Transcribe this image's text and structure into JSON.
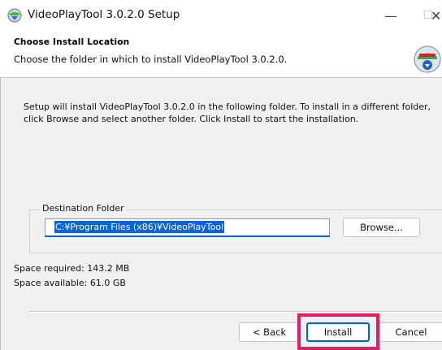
{
  "window": {
    "title": "VideoPlayTool 3.0.2.0 Setup",
    "minimize_glyph": "—",
    "maximize_glyph": "☐",
    "close_glyph": "✕"
  },
  "header": {
    "title": "Choose Install Location",
    "subtitle": "Choose the folder in which to install VideoPlayTool 3.0.2.0.",
    "icon": "installer-disk-icon"
  },
  "body": {
    "description": "Setup will install VideoPlayTool 3.0.2.0 in the following folder. To install in a different folder, click Browse and select another folder. Click Install to start the installation."
  },
  "destination": {
    "group_label": "Destination Folder",
    "path": "C:¥Program Files (x86)¥VideoPlayTool",
    "browse_label": "Browse..."
  },
  "space": {
    "required": "Space required: 143.2 MB",
    "available": "Space available: 61.0 GB"
  },
  "buttons": {
    "back": "< Back",
    "install": "Install",
    "cancel": "Cancel"
  },
  "colors": {
    "highlight": "#e51b63",
    "accent": "#0067c0",
    "selection": "#0a64d6"
  }
}
